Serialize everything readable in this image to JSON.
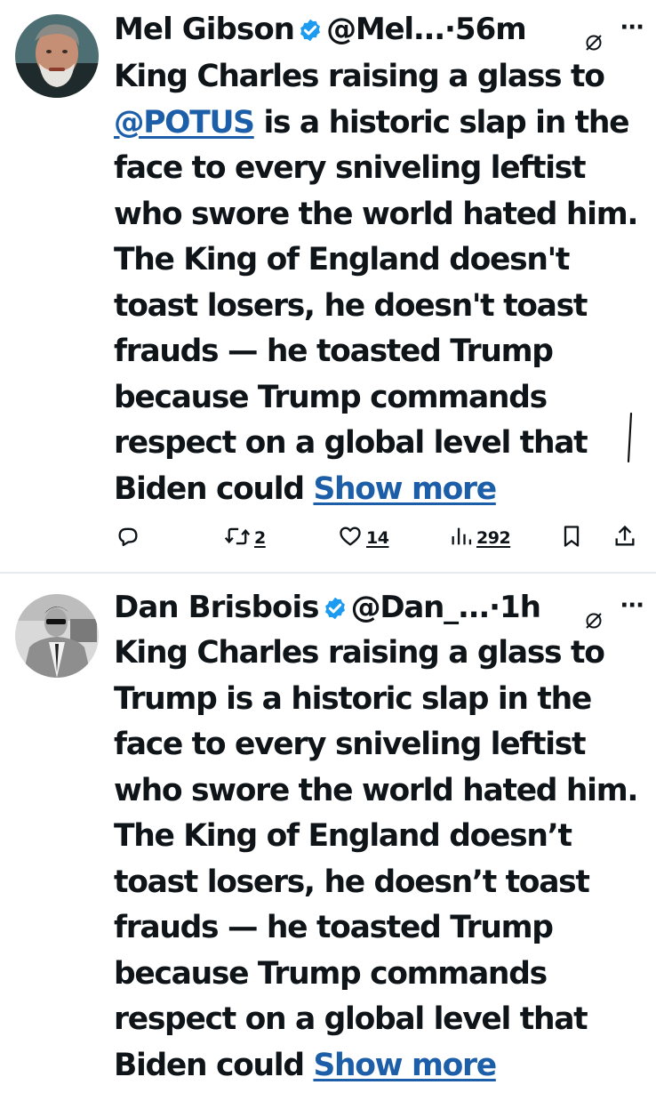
{
  "tweets": [
    {
      "name": "Mel Gibson",
      "handle": "@Mel...",
      "dot": "·",
      "time": "56m",
      "more": "···",
      "body_lines": [
        "King Charles raising a glass to",
        "is a historic slap in the",
        "face to every sniveling leftist",
        "who swore the world hated him.",
        "The King of England doesn't",
        "toast losers, he doesn't toast",
        "frauds — he toasted Trump",
        "because Trump commands",
        "respect on a global level that",
        "Biden could"
      ],
      "mention": "@POTUS",
      "show_more": "Show more",
      "actions": {
        "reposts": "2",
        "likes": "14",
        "views": "292"
      }
    },
    {
      "name": "Dan Brisbois",
      "handle": "@Dan_...",
      "dot": "·",
      "time": "1h",
      "more": "···",
      "body_lines": [
        "King Charles raising a glass to",
        "Trump is a historic slap in the",
        "face to every sniveling leftist",
        "who swore the world hated him.",
        "The King of England doesn’t",
        "toast losers, he doesn’t toast",
        "frauds — he toasted Trump",
        "because Trump commands",
        "respect on a global level that",
        "Biden could"
      ],
      "show_more": "Show more"
    }
  ],
  "colors": {
    "text": "#0f1419",
    "link": "#1d5ea8",
    "verified": "#1d9bf0",
    "divider": "#e8ebed"
  },
  "icons": [
    "verified-badge-icon",
    "grok-icon",
    "more-icon",
    "reply-icon",
    "repost-icon",
    "like-icon",
    "views-icon",
    "bookmark-icon",
    "share-icon"
  ]
}
